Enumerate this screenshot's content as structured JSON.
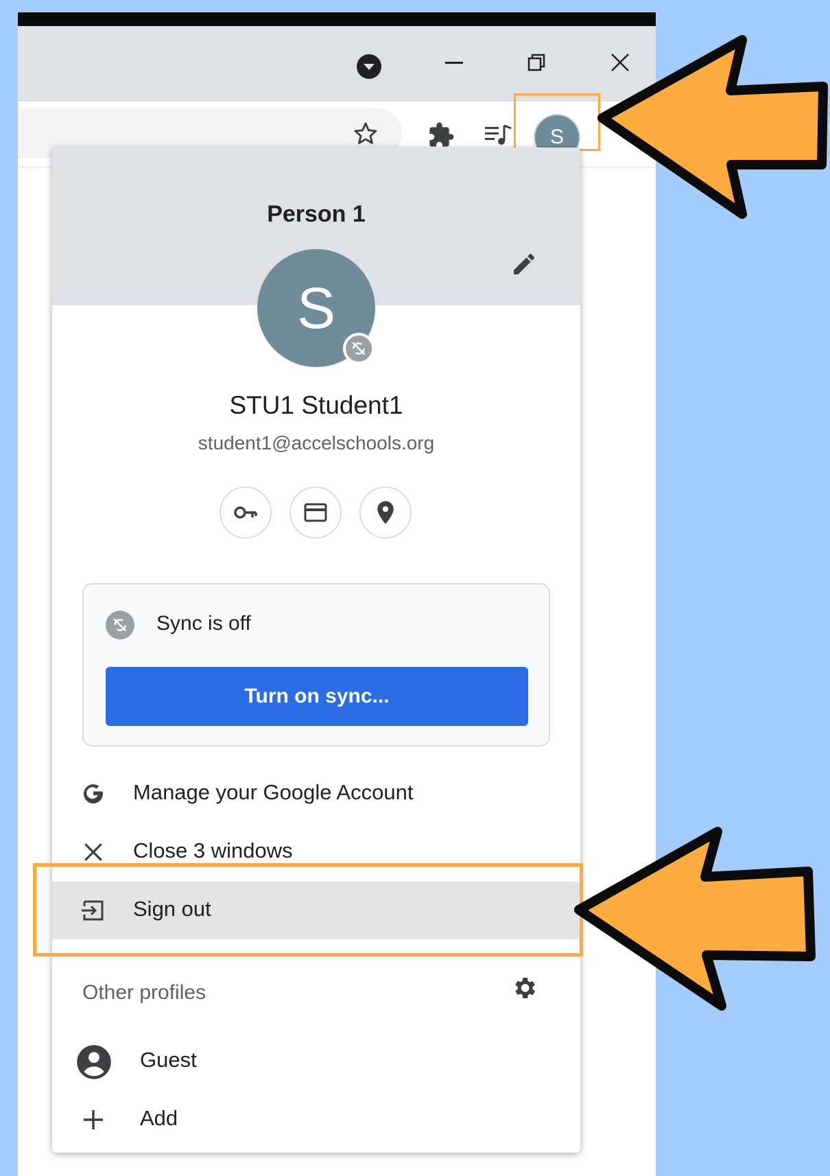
{
  "toolbar": {
    "bookmark_icon": "star-icon",
    "extensions_icon": "puzzle-icon",
    "media_icon": "media-playlist-icon",
    "profile_initial": "S"
  },
  "window_controls": {
    "profile_dropdown_icon": "chevron-down-circle-icon",
    "minimize_icon": "minimize-icon",
    "restore_icon": "restore-icon",
    "close_icon": "close-icon"
  },
  "profile_menu": {
    "profile_name": "Person 1",
    "avatar_initial": "S",
    "full_name": "STU1 Student1",
    "email": "student1@accelschools.org",
    "quick_actions": [
      "key-icon",
      "credit-card-icon",
      "location-pin-icon"
    ],
    "sync": {
      "status": "Sync is off",
      "button": "Turn on sync..."
    },
    "items": [
      {
        "label": "Manage your Google Account",
        "icon": "google-g-icon"
      },
      {
        "label": "Close 3 windows",
        "icon": "close-icon"
      },
      {
        "label": "Sign out",
        "icon": "sign-out-icon"
      }
    ],
    "other_profiles": {
      "title": "Other profiles",
      "items": [
        {
          "label": "Guest",
          "icon": "account-circle-icon"
        },
        {
          "label": "Add",
          "icon": "plus-icon"
        }
      ]
    }
  },
  "colors": {
    "background": "#a4cdfd",
    "highlight": "#ffa93f",
    "avatar": "#6f8c9a",
    "sync_button": "#2b6be4"
  }
}
